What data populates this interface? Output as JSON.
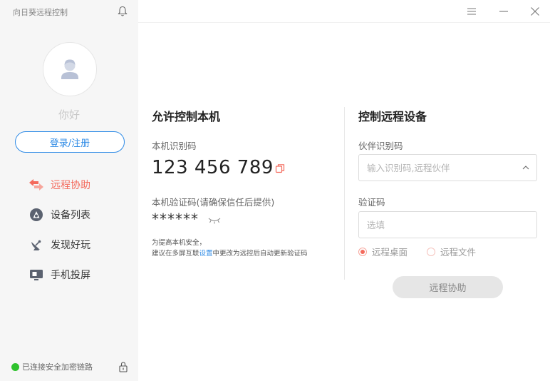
{
  "app": {
    "title": "向日葵远程控制"
  },
  "sidebar": {
    "greeting": "你好",
    "login_label": "登录/注册",
    "items": [
      {
        "label": "远程协助",
        "icon": "swap-arrows-icon",
        "active": true
      },
      {
        "label": "设备列表",
        "icon": "device-list-icon",
        "active": false
      },
      {
        "label": "发现好玩",
        "icon": "satellite-dish-icon",
        "active": false
      },
      {
        "label": "手机投屏",
        "icon": "screen-cast-icon",
        "active": false
      }
    ],
    "status": "已连接安全加密链路"
  },
  "local": {
    "title": "允许控制本机",
    "id_label": "本机识别码",
    "id_value": "123 456 789",
    "code_label": "本机验证码(请确保信任后提供)",
    "code_value": "******",
    "hint_line1": "为提高本机安全，",
    "hint_line2_pre": "建议在多屏互联",
    "hint_link": "设置",
    "hint_line2_post": "中更改为远控后自动更新验证码"
  },
  "remote": {
    "title": "控制远程设备",
    "partner_label": "伙伴识别码",
    "partner_placeholder": "输入识别码,远程伙伴",
    "code_label": "验证码",
    "code_placeholder": "选填",
    "options": [
      {
        "label": "远程桌面",
        "selected": true
      },
      {
        "label": "远程文件",
        "selected": false
      }
    ],
    "button_label": "远程协助"
  },
  "colors": {
    "accent": "#f46a5c",
    "link": "#2f8be6",
    "status_green": "#2fc22d"
  }
}
